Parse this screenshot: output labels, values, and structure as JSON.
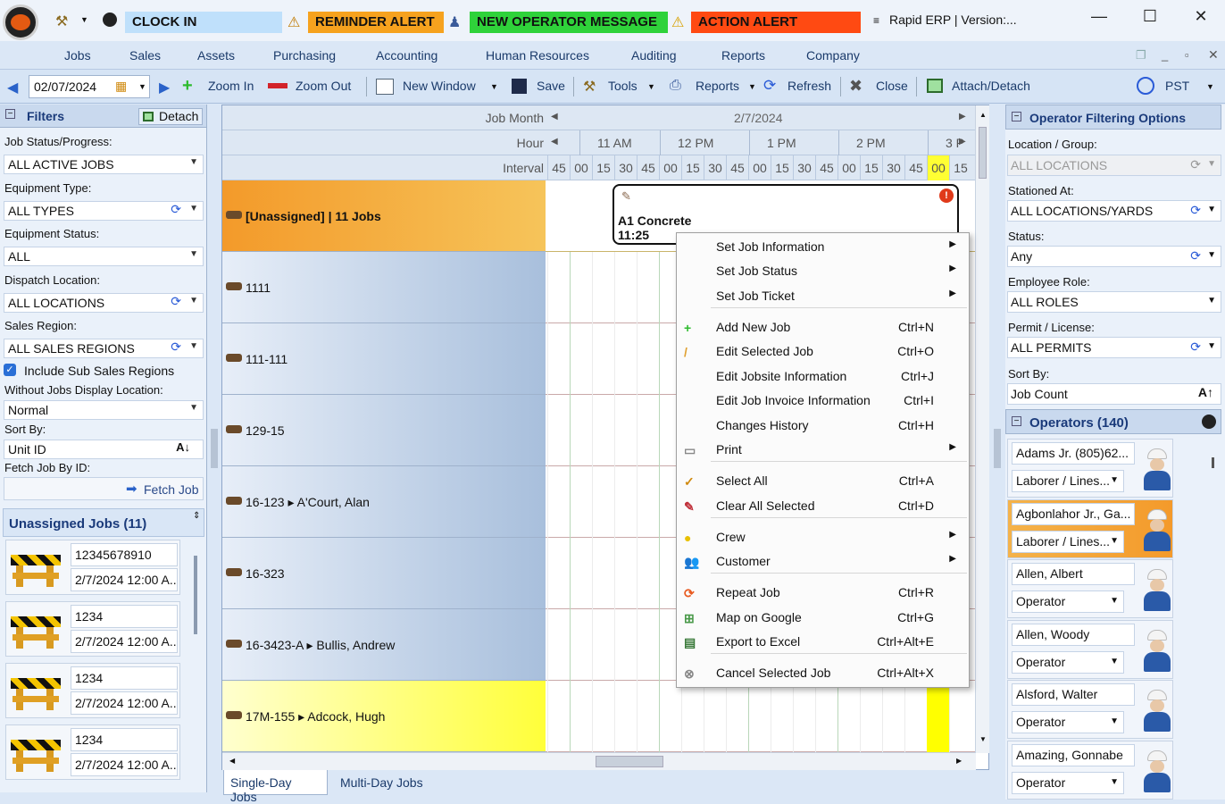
{
  "titlebar": {
    "clockin": "CLOCK IN",
    "reminder": "REMINDER ALERT",
    "operator_msg": "NEW OPERATOR MESSAGE",
    "action": "ACTION ALERT",
    "app_title": "Rapid ERP | Version:...",
    "colors": {
      "reminder": "#f6a21e",
      "operator_msg": "#2fd23a",
      "action": "#ff4a12",
      "clockin": "#bfe0fb"
    }
  },
  "menu": [
    "Jobs",
    "Sales",
    "Assets",
    "Purchasing",
    "Accounting",
    "Human Resources",
    "Auditing",
    "Reports",
    "Company"
  ],
  "toolbar": {
    "date": "02/07/2024",
    "zoom_in": "Zoom In",
    "zoom_out": "Zoom Out",
    "new_window": "New Window",
    "save": "Save",
    "tools": "Tools",
    "reports": "Reports",
    "refresh": "Refresh",
    "close": "Close",
    "attach": "Attach/Detach",
    "tz": "PST"
  },
  "filters": {
    "title": "Filters",
    "detach": "Detach",
    "job_status_label": "Job Status/Progress:",
    "job_status": "ALL ACTIVE JOBS",
    "equip_type_label": "Equipment Type:",
    "equip_type": "ALL TYPES",
    "equip_status_label": "Equipment Status:",
    "equip_status": "ALL",
    "dispatch_label": "Dispatch Location:",
    "dispatch": "ALL LOCATIONS",
    "sales_region_label": "Sales Region:",
    "sales_region": "ALL SALES REGIONS",
    "include_sub": "Include Sub Sales Regions",
    "without_jobs_label": "Without Jobs Display Location:",
    "without_jobs": "Normal",
    "sort_label": "Sort By:",
    "sort": "Unit ID",
    "fetch_label": "Fetch Job By ID:",
    "fetch_btn": "Fetch Job"
  },
  "unassigned": {
    "title": "Unassigned Jobs (11)",
    "jobs": [
      {
        "id": "12345678910",
        "date": "2/7/2024  12:00 A..."
      },
      {
        "id": "1234",
        "date": "2/7/2024  12:00 A..."
      },
      {
        "id": "1234",
        "date": "2/7/2024  12:00 A..."
      },
      {
        "id": "1234",
        "date": "2/7/2024  12:00 A..."
      }
    ]
  },
  "gantt": {
    "job_month_label": "Job Month",
    "job_month": "2/7/2024",
    "hour_label": "Hour",
    "hours": [
      "11 AM",
      "12 PM",
      "1 PM",
      "2 PM",
      "3 P"
    ],
    "interval_label": "Interval",
    "intervals": [
      "45",
      "00",
      "15",
      "30",
      "45",
      "00",
      "15",
      "30",
      "45",
      "00",
      "15",
      "30",
      "45",
      "00",
      "15",
      "30",
      "45",
      "00",
      "15"
    ],
    "rows": [
      "[Unassigned] | 11 Jobs",
      "1111",
      "111-111",
      "129-15",
      "16-123 ▸ A'Court, Alan",
      "16-323",
      "16-3423-A ▸ Bullis, Andrew",
      "17M-155 ▸ Adcock, Hugh"
    ],
    "job_block": {
      "title": "A1 Concrete",
      "time": "11:25"
    },
    "tabs": [
      "Single-Day Jobs",
      "Multi-Day Jobs"
    ]
  },
  "context_menu": [
    {
      "label": "Set Job Information",
      "shortcut": "",
      "sub": true
    },
    {
      "label": "Set Job Status",
      "shortcut": "",
      "sub": true
    },
    {
      "label": "Set Job Ticket",
      "shortcut": "",
      "sub": true
    },
    {
      "label": "Add New Job",
      "shortcut": "Ctrl+N"
    },
    {
      "label": "Edit Selected Job",
      "shortcut": "Ctrl+O"
    },
    {
      "label": "Edit Jobsite Information",
      "shortcut": "Ctrl+J"
    },
    {
      "label": "Edit Job Invoice Information",
      "shortcut": "Ctrl+I"
    },
    {
      "label": "Changes History",
      "shortcut": "Ctrl+H"
    },
    {
      "label": "Print",
      "shortcut": "",
      "sub": true
    },
    {
      "label": "Select All",
      "shortcut": "Ctrl+A"
    },
    {
      "label": "Clear All Selected",
      "shortcut": "Ctrl+D"
    },
    {
      "label": "Crew",
      "shortcut": "",
      "sub": true
    },
    {
      "label": "Customer",
      "shortcut": "",
      "sub": true
    },
    {
      "label": "Repeat Job",
      "shortcut": "Ctrl+R"
    },
    {
      "label": "Map on Google",
      "shortcut": "Ctrl+G"
    },
    {
      "label": "Export to Excel",
      "shortcut": "Ctrl+Alt+E"
    },
    {
      "label": "Cancel Selected Job",
      "shortcut": "Ctrl+Alt+X"
    }
  ],
  "operator_filter": {
    "title": "Operator Filtering Options",
    "location_label": "Location / Group:",
    "location": "ALL LOCATIONS",
    "stationed_label": "Stationed At:",
    "stationed": "ALL LOCATIONS/YARDS",
    "status_label": "Status:",
    "status": "Any",
    "role_label": "Employee Role:",
    "role": "ALL ROLES",
    "permit_label": "Permit / License:",
    "permit": "ALL PERMITS",
    "sort_label": "Sort By:",
    "sort": "Job Count",
    "operators_title": "Operators (140)"
  },
  "operators": [
    {
      "name": "Adams Jr. (805)62...",
      "role": "Laborer / Lines..."
    },
    {
      "name": "Agbonlahor Jr., Ga...",
      "role": "Laborer / Lines..."
    },
    {
      "name": "Allen, Albert",
      "role": "Operator"
    },
    {
      "name": "Allen, Woody",
      "role": "Operator"
    },
    {
      "name": "Alsford, Walter",
      "role": "Operator"
    },
    {
      "name": "Amazing, Gonnabe",
      "role": "Operator"
    }
  ]
}
